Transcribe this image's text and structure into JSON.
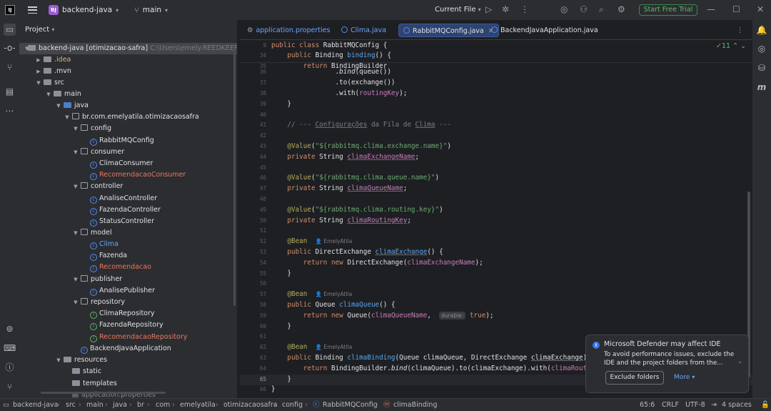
{
  "titlebar": {
    "app_logo": "IJ",
    "project_badge": "BJ",
    "project_name": "backend-java",
    "branch": "main",
    "current_file": "Current File",
    "start_trial": "Start Free Trial"
  },
  "project_panel": {
    "title": "Project",
    "root_name": "backend-java [otimizacao-safra]",
    "root_path": "C:\\Users\\emely.REEDKEEP\\Do",
    "items": [
      {
        "label": ".idea",
        "color": "olive"
      },
      {
        "label": ".mvn"
      },
      {
        "label": "src"
      },
      {
        "label": "main"
      },
      {
        "label": "java"
      },
      {
        "label": "br.com.emelyatila.otimizacaosafra"
      },
      {
        "label": "config"
      },
      {
        "label": "RabbitMQConfig"
      },
      {
        "label": "consumer"
      },
      {
        "label": "ClimaConsumer"
      },
      {
        "label": "RecomendacaoConsumer",
        "color": "red"
      },
      {
        "label": "controller"
      },
      {
        "label": "AnaliseController"
      },
      {
        "label": "FazendaController"
      },
      {
        "label": "StatusController"
      },
      {
        "label": "model"
      },
      {
        "label": "Clima",
        "color": "blue"
      },
      {
        "label": "Fazenda"
      },
      {
        "label": "Recomendacao",
        "color": "red"
      },
      {
        "label": "publisher"
      },
      {
        "label": "AnalisePublisher"
      },
      {
        "label": "repository"
      },
      {
        "label": "ClimaRepository"
      },
      {
        "label": "FazendaRepository"
      },
      {
        "label": "RecomendacaoRepository",
        "color": "red"
      },
      {
        "label": "BackendJavaApplication"
      },
      {
        "label": "resources"
      },
      {
        "label": "static"
      },
      {
        "label": "templates"
      },
      {
        "label": "application.properties"
      }
    ]
  },
  "editor": {
    "tabs": [
      {
        "label": "application.properties"
      },
      {
        "label": "Clima.java"
      },
      {
        "label": "RabbitMQConfig.java",
        "active": true
      },
      {
        "label": "BackendJavaApplication.java"
      }
    ],
    "inspection_count": "11",
    "author": "EmelyAtila",
    "inlay_hint": "durable:",
    "line_numbers": [
      "9",
      "34",
      "35",
      "36",
      "37",
      "38",
      "39",
      "40",
      "41",
      "42",
      "43",
      "44",
      "45",
      "46",
      "47",
      "48",
      "49",
      "50",
      "51",
      "52",
      "53",
      "54",
      "55",
      "56",
      "57",
      "58",
      "59",
      "60",
      "61",
      "62",
      "63",
      "64",
      "65",
      "66"
    ]
  },
  "notification": {
    "title": "Microsoft Defender may affect IDE",
    "body": "To avoid performance issues, exclude the IDE and the project folders from the...",
    "button": "Exclude folders",
    "more": "More"
  },
  "statusbar": {
    "breadcrumb": [
      "backend-java",
      "src",
      "main",
      "java",
      "br",
      "com",
      "emelyatila",
      "otimizacaosafra",
      "config",
      "RabbitMQConfig",
      "climaBinding"
    ],
    "position": "65:6",
    "line_sep": "CRLF",
    "encoding": "UTF-8",
    "indent": "4 spaces"
  },
  "colors": {
    "accent": "#3574f0",
    "trial_green": "#5fba70",
    "project_badge": "#9c5cd6"
  }
}
